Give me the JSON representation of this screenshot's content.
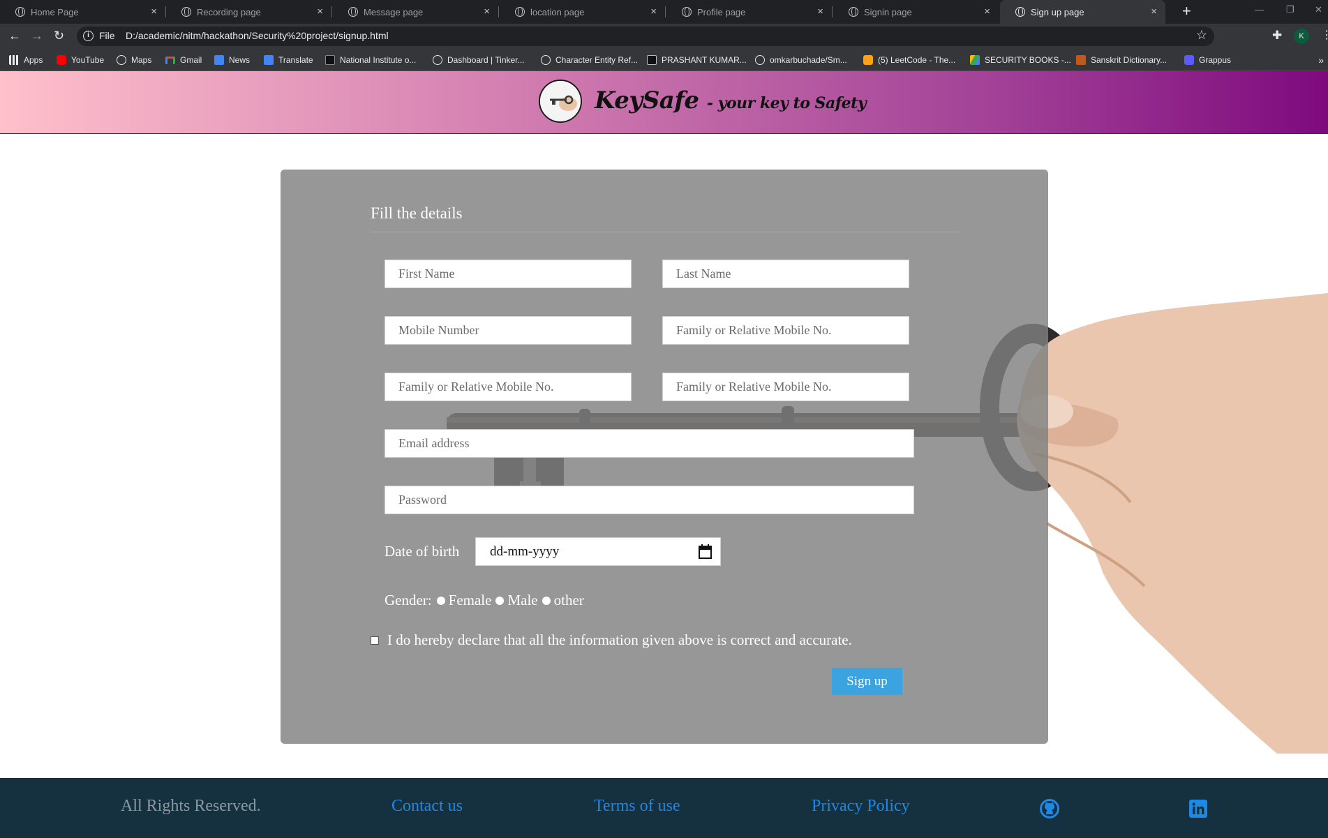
{
  "browser": {
    "tabs": [
      {
        "title": "Home Page",
        "active": false
      },
      {
        "title": "Recording page",
        "active": false
      },
      {
        "title": "Message page",
        "active": false
      },
      {
        "title": "location page",
        "active": false
      },
      {
        "title": "Profile page",
        "active": false
      },
      {
        "title": "Signin page",
        "active": false
      },
      {
        "title": "Sign up page",
        "active": true
      }
    ],
    "close_glyph": "×",
    "address": {
      "scheme": "File",
      "url": "D:/academic/nitm/hackathon/Security%20project/signup.html"
    },
    "profile_initial": "K",
    "bookmarks": [
      {
        "label": "Apps",
        "icon": "apps-grid-icon",
        "color": "#e8eaed"
      },
      {
        "label": "YouTube",
        "icon": "youtube-icon",
        "color": "#ff0000"
      },
      {
        "label": "Maps",
        "icon": "globe-icon",
        "color": "#e8eaed"
      },
      {
        "label": "Gmail",
        "icon": "gmail-icon",
        "color": "#ea4335"
      },
      {
        "label": "News",
        "icon": "news-icon",
        "color": "#4285f4"
      },
      {
        "label": "Translate",
        "icon": "translate-icon",
        "color": "#4285f4"
      },
      {
        "label": "National Institute o...",
        "icon": "institute-icon",
        "color": "#111111"
      },
      {
        "label": "Dashboard | Tinker...",
        "icon": "globe-icon",
        "color": "#e8eaed"
      },
      {
        "label": "Character Entity Ref...",
        "icon": "globe-icon",
        "color": "#e8eaed"
      },
      {
        "label": "PRASHANT KUMAR...",
        "icon": "medium-icon",
        "color": "#111111"
      },
      {
        "label": "omkarbuchade/Sm...",
        "icon": "globe-icon",
        "color": "#e8eaed"
      },
      {
        "label": "(5) LeetCode - The...",
        "icon": "leetcode-icon",
        "color": "#ffa116"
      },
      {
        "label": "SECURITY BOOKS -...",
        "icon": "drive-icon",
        "color": "#34a853"
      },
      {
        "label": "Sanskrit Dictionary...",
        "icon": "dictionary-icon",
        "color": "#c2571a"
      },
      {
        "label": "Grappus",
        "icon": "grappus-icon",
        "color": "#5b5bff"
      }
    ]
  },
  "header": {
    "brand": "KeySafe",
    "tagline": "- your key to Safety"
  },
  "form": {
    "title": "Fill the details",
    "fields": {
      "first_name": "First Name",
      "last_name": "Last Name",
      "mobile": "Mobile Number",
      "family_mobile_1": "Family or Relative Mobile No.",
      "family_mobile_2": "Family or Relative Mobile No.",
      "family_mobile_3": "Family or Relative Mobile No.",
      "email": "Email address",
      "password": "Password"
    },
    "dob_label": "Date of birth",
    "dob_placeholder": "dd-mm-yyyy",
    "gender_label": "Gender:",
    "gender_options": [
      "Female",
      "Male",
      "other"
    ],
    "declaration": "I do hereby declare that all the information given above is correct and accurate.",
    "submit": "Sign up"
  },
  "footer": {
    "copyright": "All Rights Reserved.",
    "links": [
      "Contact us",
      "Terms of use",
      "Privacy Policy"
    ],
    "social": [
      "github-icon",
      "linkedin-icon"
    ]
  },
  "colors": {
    "header_gradient": [
      "#ffc0cb",
      "#7e0a7e"
    ],
    "card": "#8c8c8c",
    "button": "#3ba3e0",
    "footer": "#15303f",
    "link": "#1e88e5"
  }
}
